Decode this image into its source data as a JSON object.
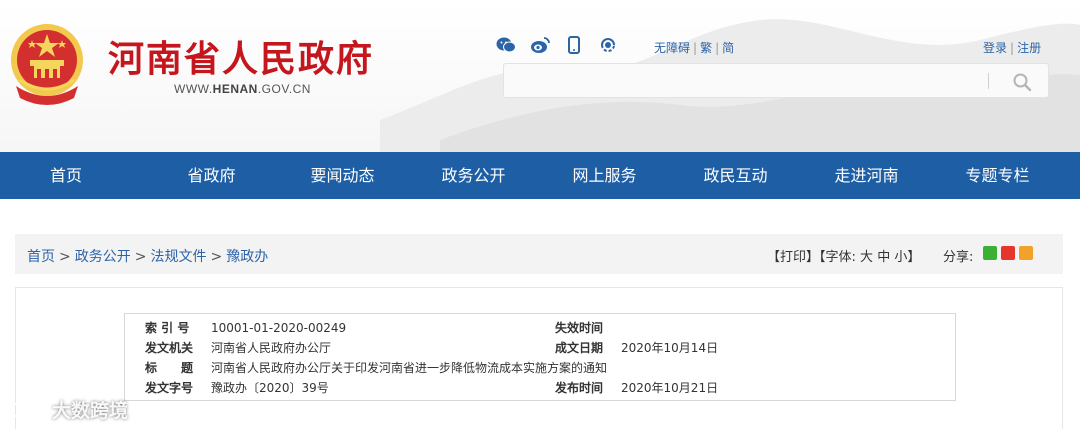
{
  "header": {
    "site_title": "河南省人民政府",
    "site_url_prefix": "WWW.",
    "site_url_domain": "HENAN",
    "site_url_suffix": ".GOV.CN",
    "accessibility": "无障碍",
    "traditional": "繁",
    "simplified": "简",
    "login": "登录",
    "register": "注册",
    "search_placeholder": "",
    "social_icons": [
      "wechat-icon",
      "weibo-icon",
      "mobile-icon",
      "podcast-icon"
    ]
  },
  "nav": {
    "items": [
      "首页",
      "省政府",
      "要闻动态",
      "政务公开",
      "网上服务",
      "政民互动",
      "走进河南",
      "专题专栏"
    ]
  },
  "breadcrumb": {
    "items": [
      "首页",
      "政务公开",
      "法规文件",
      "豫政办"
    ],
    "separator": ">"
  },
  "tools": {
    "print": "【打印】",
    "font_label": "【字体:",
    "font_large": "大",
    "font_medium": "中",
    "font_small": "小",
    "font_close": "】",
    "share_label": "分享:",
    "share_icons": [
      "wechat-share-icon",
      "weibo-share-icon",
      "qq-share-icon"
    ]
  },
  "meta": {
    "index_label": "索 引 号",
    "index_value": "10001-01-2020-00249",
    "effective_label": "失效时间",
    "effective_value": "",
    "issuer_label": "发文机关",
    "issuer_value": "河南省人民政府办公厅",
    "created_label": "成文日期",
    "created_value": "2020年10月14日",
    "title_label": "标　　题",
    "title_value": "河南省人民政府办公厅关于印发河南省进一步降低物流成本实施方案的通知",
    "docno_label": "发文字号",
    "docno_value": "豫政办〔2020〕39号",
    "published_label": "发布时间",
    "published_value": "2020年10月21日"
  },
  "watermark": {
    "text": "大数跨境"
  },
  "colors": {
    "brand_red": "#c4161c",
    "nav_blue": "#1e5ea4",
    "link_blue": "#2c64a8"
  }
}
